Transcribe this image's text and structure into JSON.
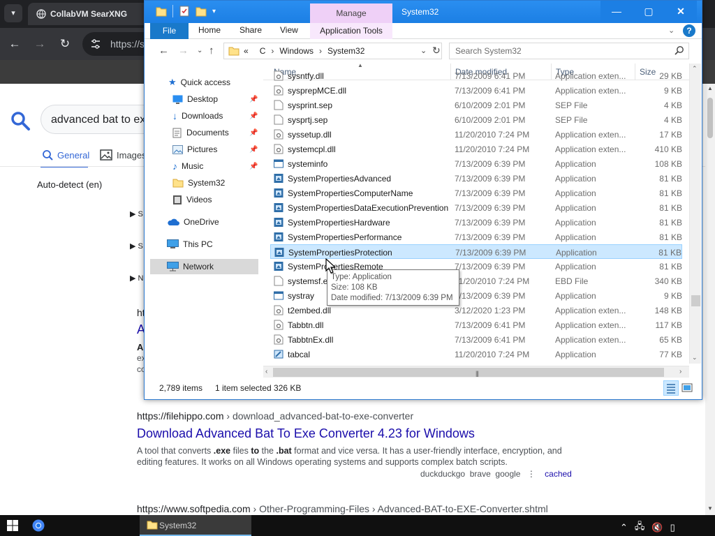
{
  "browser": {
    "tab_title": "CollabVM SearXNG",
    "url_fragment": "https://s",
    "tab_menu_icon": "chevron-down-icon"
  },
  "search_page": {
    "query_fragment": "advanced bat to ex",
    "tabs": [
      {
        "label": "General",
        "icon": "search-icon"
      },
      {
        "label": "Images",
        "icon": "image-icon"
      }
    ],
    "language": "Auto-detect (en)",
    "partial_results": {
      "collapse_letters": [
        "S",
        "S",
        "N"
      ],
      "url_fragment": "ht",
      "title_fragment": "A",
      "bold_fragment": "A",
      "snippet_fragments": [
        "ex",
        "co"
      ]
    },
    "results": [
      {
        "url_domain": "https://filehippo.com",
        "url_path": "› download_advanced-bat-to-exe-converter",
        "title": "Download Advanced Bat To Exe Converter 4.23 for Windows",
        "snippet_parts": [
          "A tool that converts ",
          ".exe",
          " files ",
          "to",
          " the ",
          ".bat",
          " format and vice versa. It has a user-friendly interface, encryption, and editing features. It works on all Windows operating systems and supports complex batch scripts."
        ],
        "engines": [
          "duckduckgo",
          "brave",
          "google"
        ],
        "cached_label": "cached"
      },
      {
        "url_domain": "https://www.softpedia.com",
        "url_path": "› Other-Programming-Files › Advanced-BAT-to-EXE-Converter.shtml"
      }
    ]
  },
  "explorer": {
    "title": "System32",
    "manage_label": "Manage",
    "ribbon_tabs": [
      "File",
      "Home",
      "Share",
      "View",
      "Application Tools"
    ],
    "address_path": [
      "«",
      "C",
      "Windows",
      "System32"
    ],
    "search_placeholder": "Search System32",
    "nav": [
      {
        "label": "Quick access",
        "icon": "star-icon"
      },
      {
        "label": "Desktop",
        "icon": "desktop-icon",
        "pinned": true
      },
      {
        "label": "Downloads",
        "icon": "download-icon",
        "pinned": true
      },
      {
        "label": "Documents",
        "icon": "documents-icon",
        "pinned": true
      },
      {
        "label": "Pictures",
        "icon": "pictures-icon",
        "pinned": true
      },
      {
        "label": "Music",
        "icon": "music-icon",
        "pinned": true
      },
      {
        "label": "System32",
        "icon": "folder-icon"
      },
      {
        "label": "Videos",
        "icon": "videos-icon"
      },
      {
        "label": "OneDrive",
        "icon": "cloud-icon"
      },
      {
        "label": "This PC",
        "icon": "computer-icon"
      },
      {
        "label": "Network",
        "icon": "network-icon",
        "selected": true
      }
    ],
    "columns": [
      "Name",
      "Date modified",
      "Type",
      "Size"
    ],
    "files": [
      {
        "name": "sysntfy.dll",
        "date": "7/13/2009 6:41 PM",
        "type": "Application exten...",
        "size": "29 KB",
        "icon": "dll"
      },
      {
        "name": "sysprepMCE.dll",
        "date": "7/13/2009 6:41 PM",
        "type": "Application exten...",
        "size": "9 KB",
        "icon": "dll"
      },
      {
        "name": "sysprint.sep",
        "date": "6/10/2009 2:01 PM",
        "type": "SEP File",
        "size": "4 KB",
        "icon": "file"
      },
      {
        "name": "sysprtj.sep",
        "date": "6/10/2009 2:01 PM",
        "type": "SEP File",
        "size": "4 KB",
        "icon": "file"
      },
      {
        "name": "syssetup.dll",
        "date": "11/20/2010 7:24 PM",
        "type": "Application exten...",
        "size": "17 KB",
        "icon": "dll"
      },
      {
        "name": "systemcpl.dll",
        "date": "11/20/2010 7:24 PM",
        "type": "Application exten...",
        "size": "410 KB",
        "icon": "dll"
      },
      {
        "name": "systeminfo",
        "date": "7/13/2009 6:39 PM",
        "type": "Application",
        "size": "108 KB",
        "icon": "exe"
      },
      {
        "name": "SystemPropertiesAdvanced",
        "date": "7/13/2009 6:39 PM",
        "type": "Application",
        "size": "81 KB",
        "icon": "sysprop"
      },
      {
        "name": "SystemPropertiesComputerName",
        "date": "7/13/2009 6:39 PM",
        "type": "Application",
        "size": "81 KB",
        "icon": "sysprop"
      },
      {
        "name": "SystemPropertiesDataExecutionPrevention",
        "date": "7/13/2009 6:39 PM",
        "type": "Application",
        "size": "81 KB",
        "icon": "sysprop"
      },
      {
        "name": "SystemPropertiesHardware",
        "date": "7/13/2009 6:39 PM",
        "type": "Application",
        "size": "81 KB",
        "icon": "sysprop"
      },
      {
        "name": "SystemPropertiesPerformance",
        "date": "7/13/2009 6:39 PM",
        "type": "Application",
        "size": "81 KB",
        "icon": "sysprop"
      },
      {
        "name": "SystemPropertiesProtection",
        "date": "7/13/2009 6:39 PM",
        "type": "Application",
        "size": "81 KB",
        "icon": "sysprop",
        "selected": true
      },
      {
        "name": "SystemPropertiesRemote",
        "date": "7/13/2009 6:39 PM",
        "type": "Application",
        "size": "81 KB",
        "icon": "sysprop"
      },
      {
        "name": "systemsf.ebd",
        "date": "11/20/2010 7:24 PM",
        "type": "EBD File",
        "size": "340 KB",
        "icon": "file"
      },
      {
        "name": "systray",
        "date": "7/13/2009 6:39 PM",
        "type": "Application",
        "size": "9 KB",
        "icon": "exe"
      },
      {
        "name": "t2embed.dll",
        "date": "3/12/2020 1:23 PM",
        "type": "Application exten...",
        "size": "148 KB",
        "icon": "dll"
      },
      {
        "name": "Tabbtn.dll",
        "date": "7/13/2009 6:41 PM",
        "type": "Application exten...",
        "size": "117 KB",
        "icon": "dll"
      },
      {
        "name": "TabbtnEx.dll",
        "date": "7/13/2009 6:41 PM",
        "type": "Application exten...",
        "size": "65 KB",
        "icon": "dll"
      },
      {
        "name": "tabcal",
        "date": "11/20/2010 7:24 PM",
        "type": "Application",
        "size": "77 KB",
        "icon": "tabcal"
      }
    ],
    "status_items": "2,789 items",
    "status_selected": "1 item selected  326 KB",
    "tooltip": {
      "type_line": "Type: Application",
      "size_line": "Size: 108 KB",
      "date_line": "Date modified: 7/13/2009 6:39 PM"
    }
  },
  "taskbar": {
    "explorer_label": "System32"
  },
  "colors": {
    "titlebar": "#1c7fe4",
    "selection": "#cce8ff",
    "manage_tab": "#efd0f7",
    "link": "#1a0dab"
  }
}
